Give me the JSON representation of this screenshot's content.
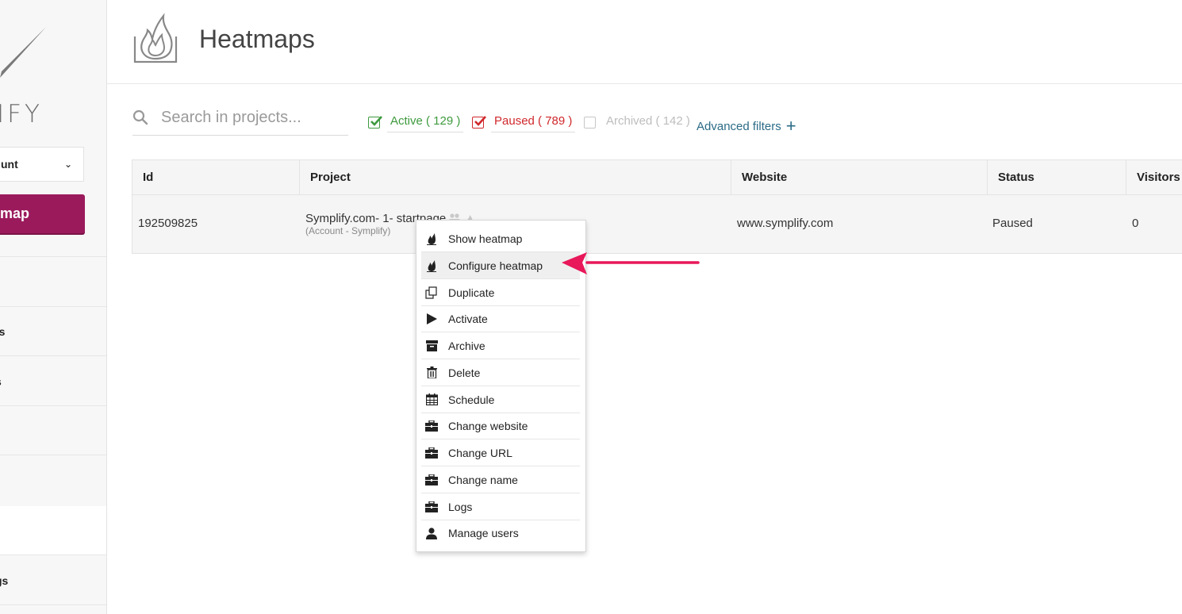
{
  "sidebar": {
    "logo_text": "IFY",
    "account_label": "unt",
    "new_button_label": "map",
    "items": [
      {
        "label": "ts"
      },
      {
        "label": "s"
      },
      {
        "label": "gs"
      }
    ]
  },
  "header": {
    "title": "Heatmaps"
  },
  "search": {
    "placeholder": "Search in projects..."
  },
  "filters": {
    "active": "Active ( 129 )",
    "paused": "Paused ( 789 )",
    "archived": "Archived ( 142 )",
    "advanced": "Advanced filters",
    "advanced_icon": "+"
  },
  "table": {
    "columns": [
      "Id",
      "Project",
      "Website",
      "Status",
      "Visitors"
    ],
    "rows": [
      {
        "id": "192509825",
        "project": "Symplify.com- 1- startpage",
        "project_sub": "(Account - Symplify)",
        "website": "www.symplify.com",
        "status": "Paused",
        "visitors": "0"
      }
    ]
  },
  "menu": {
    "items": [
      {
        "label": "Show heatmap",
        "icon": "flame-icon"
      },
      {
        "label": "Configure heatmap",
        "icon": "flame-icon"
      },
      {
        "label": "Duplicate",
        "icon": "copy-icon"
      },
      {
        "label": "Activate",
        "icon": "play-icon"
      },
      {
        "label": "Archive",
        "icon": "archive-icon"
      },
      {
        "label": "Delete",
        "icon": "trash-icon"
      },
      {
        "label": "Schedule",
        "icon": "calendar-icon"
      },
      {
        "label": "Change website",
        "icon": "briefcase-icon"
      },
      {
        "label": "Change URL",
        "icon": "briefcase-icon"
      },
      {
        "label": "Change name",
        "icon": "briefcase-icon"
      },
      {
        "label": "Logs",
        "icon": "briefcase-icon"
      },
      {
        "label": "Manage users",
        "icon": "user-icon"
      }
    ],
    "highlighted": "Configure heatmap"
  },
  "colors": {
    "brand": "#9b1a5c",
    "active": "#3e9a3e",
    "paused": "#d0282c",
    "link": "#2b6b86",
    "arrow": "#e8185a"
  }
}
